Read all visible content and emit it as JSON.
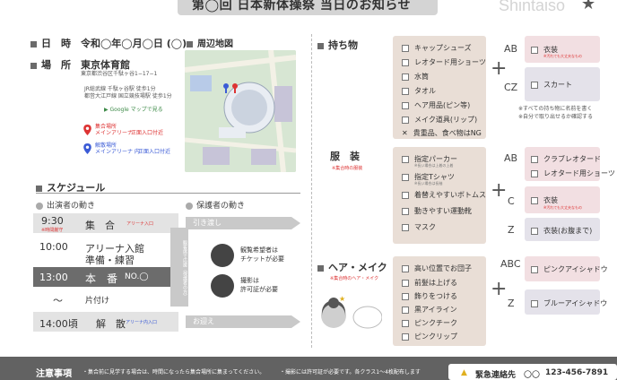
{
  "header": {
    "title": "第◯回 日本新体操祭 当日のお知らせ",
    "brand": "Shintaiso"
  },
  "info": {
    "date_label": "日　時",
    "date_value": "令和◯年◯月◯日 (◯)",
    "place_label": "場　所",
    "place_value": "東京体育館",
    "address": "東京都渋谷区千駄ヶ谷1−17−1",
    "access_1": "JR総武線 千駄ヶ谷駅 徒歩1分",
    "access_2": "都営大江戸線 国立競技場駅 徒歩1分",
    "map_link": "Google マップで見る",
    "meeting_label": "集合場所",
    "meeting_place": "メインアリーナ",
    "meeting_entrance": "正面入口付近",
    "dismiss_label": "解散場所",
    "dismiss_place": "メインアリーナ 内",
    "dismiss_entrance": "正面入口付近"
  },
  "map": {
    "heading": "周辺地図"
  },
  "schedule": {
    "heading": "スケジュール",
    "performers_heading": "出演者の動き",
    "guardians_heading": "保護者の動き",
    "rows": [
      {
        "time": "9:30",
        "label": "集　合",
        "note": "※時間厳守",
        "tag": "アリーナ入口"
      },
      {
        "time": "10:00",
        "label": "アリーナ入館",
        "label2": "準備・練習"
      },
      {
        "time": "13:00",
        "label": "本　番",
        "tag": "NO.◯"
      },
      {
        "time": "〜",
        "label": "片付け"
      },
      {
        "time": "14:00頃",
        "label": "解　散",
        "tag": "アリーナ内入口"
      }
    ],
    "handover": "引き渡し",
    "pickup": "お迎え",
    "vertical_note": "観客席で応援（保護者の方）",
    "viewing_note_1": "観覧希望者は",
    "viewing_note_2": "チケットが必要",
    "photo_note_1": "撮影は",
    "photo_note_2": "許可証が必要"
  },
  "belongings": {
    "heading": "持ち物",
    "items": [
      "キャップシューズ",
      "レオタード用ショーツ",
      "水筒",
      "タオル",
      "ヘア用品(ピン等)",
      "メイク道具(リップ)",
      "貴重品、食べ物はNG"
    ],
    "groups": [
      {
        "code": "AB",
        "items": [
          "衣装"
        ],
        "note": "※汚れても大丈夫なもの"
      },
      {
        "code": "CZ",
        "items": [
          "スカート"
        ]
      }
    ],
    "note_1": "※すべての持ち物に名前を書く",
    "note_2": "※自分で取り出せるか確認する"
  },
  "clothes": {
    "heading": "服　装",
    "sub": "※集合時の服装",
    "items": [
      {
        "label": "指定パーカー",
        "note": "※長い場合は上着の上着"
      },
      {
        "label": "指定Tシャツ",
        "note": "※長い場合は長袖"
      },
      {
        "label": "着替えやすいボトムス"
      },
      {
        "label": "動きやすい運動靴"
      },
      {
        "label": "マスク"
      }
    ],
    "groups": [
      {
        "code": "AB",
        "items": [
          "クラブレオタード",
          "レオタード用ショーツ"
        ]
      },
      {
        "code": "C",
        "items": [
          "衣装"
        ],
        "note": "※汚れても大丈夫なもの"
      },
      {
        "code": "Z",
        "items": [
          "衣装(お腹まで)"
        ]
      }
    ]
  },
  "hairmake": {
    "heading": "ヘア・メイク",
    "sub": "※集合時のヘア・メイク",
    "items": [
      "高い位置でお団子",
      "前髪は上げる",
      "飾りをつける",
      "黒アイライン",
      "ピンクチーク",
      "ピンクリップ"
    ],
    "groups": [
      {
        "code": "ABC",
        "items": [
          "ピンクアイシャドウ"
        ]
      },
      {
        "code": "Z",
        "items": [
          "ブルーアイシャドウ"
        ]
      }
    ]
  },
  "footer": {
    "heading": "注意事項",
    "text_1": "・集合前に見学する場合は、時間になったら集合場所に集まってください。",
    "text_2": "・撮影には許可証が必要です。各クラス1〜4枚配布します",
    "emergency_label": "緊急連絡先",
    "emergency_name": "〇〇",
    "emergency_number": "123-456-7891"
  },
  "colors": {
    "accent_red": "#d33333",
    "accent_blue": "#3b5bd6",
    "beige": "#e9ded6",
    "pink": "#f2dfe2",
    "lavender": "#e4e2ea"
  }
}
